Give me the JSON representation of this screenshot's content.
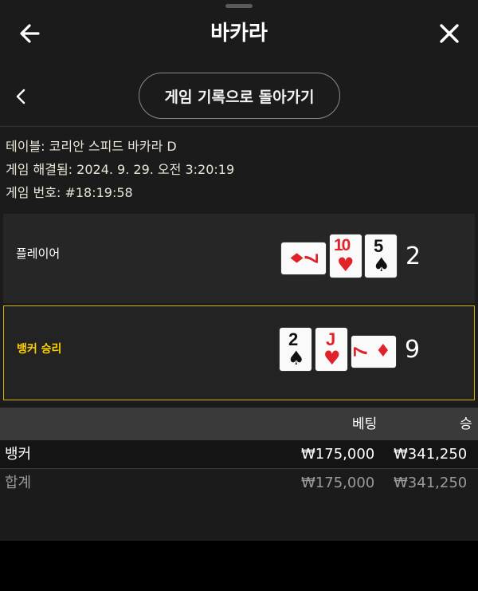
{
  "header": {
    "title": "바카라"
  },
  "history_button": {
    "label": "게임 기록으로 돌아가기"
  },
  "game_info": {
    "table": "테이블: 코리안 스피드 바카라 D",
    "resolved": "게임 해결됨: 2024. 9. 29. 오전 3:20:19",
    "number": "게임 번호: #18:19:58"
  },
  "player": {
    "label": "플레이어",
    "score": "2",
    "cards": [
      {
        "rank": "7",
        "suit": "♦",
        "color": "#e0232b"
      },
      {
        "rank": "10",
        "suit": "♥",
        "color": "#e0232b"
      },
      {
        "rank": "5",
        "suit": "♠",
        "color": "#111111"
      }
    ]
  },
  "banker": {
    "label": "뱅커 승리",
    "score": "9",
    "cards": [
      {
        "rank": "2",
        "suit": "♠",
        "color": "#111111"
      },
      {
        "rank": "J",
        "suit": "♥",
        "color": "#e0232b"
      },
      {
        "rank": "7",
        "suit": "♦",
        "color": "#e0232b"
      }
    ]
  },
  "bets_table": {
    "headers": {
      "bet": "베팅",
      "win": "승"
    },
    "rows": [
      {
        "name": "뱅커",
        "bet": "₩175,000",
        "win": "₩341,250"
      },
      {
        "name": "합계",
        "bet": "₩175,000",
        "win": "₩341,250"
      }
    ]
  },
  "colors": {
    "accent": "#ffd000",
    "panel": "#1b1b1b",
    "red_suit": "#e0232b"
  }
}
